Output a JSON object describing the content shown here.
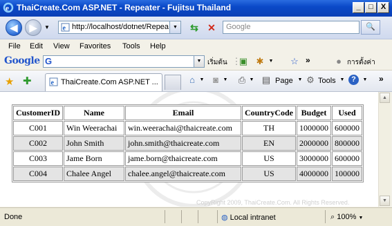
{
  "window": {
    "title": "ThaiCreate.Com ASP.NET - Repeater - Fujitsu Thailand",
    "min_label": "_",
    "max_label": "□",
    "close_label": "X"
  },
  "nav": {
    "address": "http://localhost/dotnet/Repeater",
    "search_placeholder": "Google",
    "search_button_label": "🔍"
  },
  "menu": [
    "File",
    "Edit",
    "View",
    "Favorites",
    "Tools",
    "Help"
  ],
  "google_toolbar": {
    "logo": "Google",
    "search_prefix": "G",
    "start_label": "เริ่มต้น",
    "more_label": "»",
    "settings_label": "การตั้งค่า"
  },
  "tabs": {
    "active_label": "ThaiCreate.Com ASP.NET ...",
    "page_label": "Page",
    "tools_label": "Tools",
    "more_label": "»"
  },
  "table": {
    "headers": [
      "CustomerID",
      "Name",
      "Email",
      "CountryCode",
      "Budget",
      "Used"
    ],
    "rows": [
      [
        "C001",
        "Win Weerachai",
        "win.weerachai@thaicreate.com",
        "TH",
        "1000000",
        "600000"
      ],
      [
        "C002",
        "John Smith",
        "john.smith@thaicreate.com",
        "EN",
        "2000000",
        "800000"
      ],
      [
        "C003",
        "Jame Born",
        "jame.born@thaicreate.com",
        "US",
        "3000000",
        "600000"
      ],
      [
        "C004",
        "Chalee Angel",
        "chalee.angel@thaicreate.com",
        "US",
        "4000000",
        "100000"
      ]
    ]
  },
  "content": {
    "copyright": "CopyRight 2009, ThaiCreate.Com. All Rights Reserved."
  },
  "status": {
    "text": "Done",
    "zone": "Local intranet",
    "zoom": "100%"
  },
  "colors": {
    "titlebar": "#0a49c8",
    "alt_row": "#e4e4e4"
  }
}
